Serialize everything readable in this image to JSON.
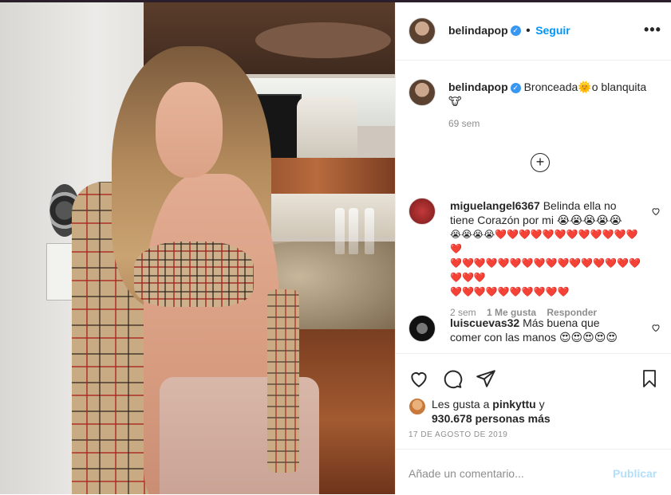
{
  "post": {
    "username": "belindapop",
    "follow_label": "Seguir",
    "more_label": "•••",
    "separator": "•"
  },
  "caption": {
    "username": "belindapop",
    "text_line1": "Bronceada🌞o blanquita",
    "text_line2": "🐮",
    "age": "69 sem"
  },
  "load_more_label": "+",
  "comments": [
    {
      "username": "miguelangel6367",
      "lines": [
        "Belinda ella no",
        "tiene Corazón por mi 😭😭😭😭😭",
        "😭😭😭😭❤️❤️❤️❤️❤️❤️❤️❤️❤️❤️❤️❤️❤️",
        "❤️❤️❤️❤️❤️❤️❤️❤️❤️❤️❤️❤️❤️❤️❤️❤️❤️❤️❤️",
        "❤️❤️❤️❤️❤️❤️❤️❤️❤️❤️"
      ],
      "age": "2 sem",
      "likes": "1 Me gusta",
      "reply": "Responder"
    },
    {
      "username": "luiscuevas32",
      "lines": [
        "Más buena que",
        "comer con las manos 😍😍😍😍😍"
      ]
    }
  ],
  "likes": {
    "prefix": "Les gusta a",
    "user": "pinkyttu",
    "conj": "y",
    "count_text": "930.678 personas más"
  },
  "date": "17 DE AGOSTO DE 2019",
  "comment_box": {
    "placeholder": "Añade un comentario...",
    "publish": "Publicar"
  },
  "icons": {
    "verified": "verified-badge-icon",
    "like": "heart-icon",
    "comment": "comment-icon",
    "share": "paper-plane-icon",
    "save": "bookmark-icon"
  },
  "colors": {
    "accent": "#0095f6",
    "verified": "#3897f0",
    "publish_disabled": "#b2dffc"
  }
}
